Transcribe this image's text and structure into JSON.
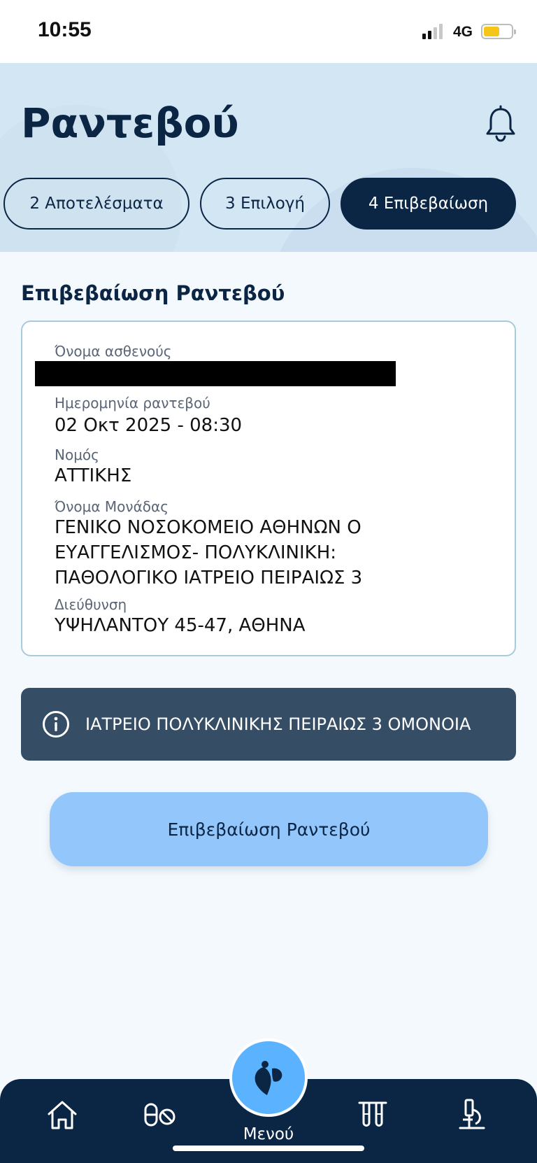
{
  "status_bar": {
    "time": "10:55",
    "network": "4G",
    "battery_color": "#f5c518"
  },
  "header": {
    "title": "Ραντεβού",
    "bell_icon": "bell-icon",
    "steps": [
      {
        "label": "2 Αποτελέσματα",
        "active": false
      },
      {
        "label": "3 Επιλογή",
        "active": false
      },
      {
        "label": "4 Επιβεβαίωση",
        "active": true
      }
    ]
  },
  "section_title": "Επιβεβαίωση Ραντεβού",
  "card": {
    "patient_name_label": "Όνομα ασθενούς",
    "date_label": "Ημερομηνία ραντεβού",
    "date_value": "02 Οκτ 2025 - 08:30",
    "prefecture_label": "Νομός",
    "prefecture_value": "ΑΤΤΙΚΗΣ",
    "unit_label": "Όνομα Μονάδας",
    "unit_lines": [
      "ΓΕΝΙΚΟ ΝΟΣΟΚΟΜΕΙΟ ΑΘΗΝΩΝ Ο",
      "ΕΥΑΓΓΕΛΙΣΜΟΣ- ΠΟΛΥΚΛΙΝΙΚΗ:",
      "ΠΑΘΟΛΟΓΙΚΟ ΙΑΤΡΕΙΟ  ΠΕΙΡΑΙΩΣ 3"
    ],
    "address_label": "Διεύθυνση",
    "address_value": "ΥΨΗΛΑΝΤΟΥ 45-47, ΑΘΗΝΑ"
  },
  "info_banner": {
    "icon": "info-icon",
    "text": "ΙΑΤΡΕΙΟ ΠΟΛΥΚΛΙΝΙΚΗΣ ΠΕΙΡΑΙΩΣ 3 ΟΜΟΝΟΙΑ"
  },
  "confirm_button": {
    "label": "Επιβεβαίωση Ραντεβού"
  },
  "bottom_nav": {
    "menu_label": "Μενού",
    "items": [
      "home-icon",
      "medication-icon",
      "menu-logo-icon",
      "test-tubes-icon",
      "microscope-icon"
    ]
  },
  "colors": {
    "primary": "#0b2545",
    "header_bg": "#d3e6f3",
    "banner_bg": "#354e66",
    "button_bg": "#93c7fb",
    "fab_bg": "#5bb3ff"
  }
}
